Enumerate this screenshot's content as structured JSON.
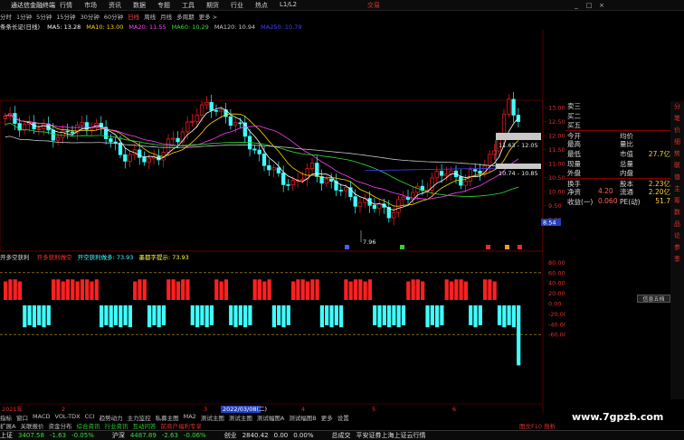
{
  "menubar": {
    "app_title": "通达信金融终端",
    "items": [
      "行情",
      "市场",
      "资讯",
      "数据",
      "专题",
      "工具",
      "期货",
      "行业",
      "热点",
      "L1/L2"
    ],
    "brand": "交易",
    "win_controls": [
      "_",
      "□",
      "×"
    ]
  },
  "timeframes": [
    "分时",
    "1分钟",
    "5分钟",
    "15分钟",
    "30分钟",
    "60分钟",
    "日线",
    "周线",
    "月线",
    "多周期",
    "更多 >"
  ],
  "active_timeframe": "日线",
  "ma_legend": {
    "stock": "条条长证(日线)",
    "items": [
      {
        "label": "MA5: 13.28",
        "color": "#ffffff"
      },
      {
        "label": "MA10: 13.00",
        "color": "#ffd700"
      },
      {
        "label": "MA20: 11.55",
        "color": "#ff40ff"
      },
      {
        "label": "MA60: 10.29",
        "color": "#30e030"
      },
      {
        "label": "MA120: 10.94",
        "color": "#c8c8c8"
      },
      {
        "label": "MA250: 10.79",
        "color": "#4040ff"
      }
    ]
  },
  "price_axis": [
    "13.00",
    "12.50",
    "12.00",
    "11.50",
    "11.00",
    "10.50",
    "10.00",
    "9.50",
    "9.00"
  ],
  "annotations": {
    "low_label": "7.96",
    "box1": "11.63 - 12.05",
    "box2": "10.74 - 10.85",
    "last_price": "8.54"
  },
  "quote": {
    "rows": [
      {
        "l": "卖三",
        "v": "",
        "l2": "",
        "v2": ""
      },
      {
        "l": "买二",
        "v": "",
        "l2": "",
        "v2": ""
      },
      {
        "l": "买五",
        "v": "",
        "l2": "",
        "v2": ""
      },
      {
        "l": "今开",
        "v": "",
        "l2": "均价",
        "v2": ""
      },
      {
        "l": "最高",
        "v": "",
        "l2": "量比",
        "v2": ""
      },
      {
        "l": "最低",
        "v": "",
        "l2": "市值",
        "v2": "27.7亿"
      },
      {
        "l": "现量",
        "v": "",
        "l2": "总量",
        "v2": ""
      },
      {
        "l": "外盘",
        "v": "",
        "l2": "内盘",
        "v2": ""
      },
      {
        "l": "换手",
        "v": "",
        "l2": "股本",
        "v2": "2.23亿"
      },
      {
        "l": "净资",
        "v": "4.20",
        "l2": "流通",
        "v2": "2.20亿"
      },
      {
        "l": "收益(一)",
        "v": "0.060",
        "l2": "PE(动)",
        "v2": "51.7"
      }
    ]
  },
  "indicator": {
    "title": "开多空获利",
    "items": [
      {
        "label": "开多获利做空",
        "color": "#ff3030"
      },
      {
        "label": "开空获利做多: 73.93",
        "color": "#40ffff"
      },
      {
        "label": "墨都字提示: 73.93",
        "color": "#ffff40"
      }
    ],
    "axis": [
      "80.00",
      "60.00",
      "40.00",
      "20.00",
      "0.00",
      "-20.00",
      "-40.00",
      "-60.00"
    ]
  },
  "date_axis": {
    "left": "2021年",
    "mid": "2022/03/08(二)",
    "ticks": [
      "2",
      "3",
      "4",
      "5",
      "6"
    ]
  },
  "tabs_row1": [
    "指标",
    "窗口",
    "MACD",
    "VOL-TDX",
    "CCI",
    "趋势动力",
    "主力监控",
    "私募主图",
    "MA2",
    "测试主图",
    "测试主图",
    "测试幅图A",
    "测试幅图B",
    "更多",
    "设置"
  ],
  "tabs_row2": [
    "扩展A",
    "关联报价",
    "资金分布",
    "综合资讯",
    "行业资讯",
    "互动问答",
    "前商户福利专享"
  ],
  "statusbar": [
    {
      "t": "上证",
      "c": "#e0e0e0"
    },
    {
      "t": "3407.58",
      "c": "#30e030"
    },
    {
      "t": "-1.63",
      "c": "#30e030"
    },
    {
      "t": "-0.05%",
      "c": "#30e030"
    },
    {
      "t": "沪深",
      "c": "#e0e0e0"
    },
    {
      "t": "4487.89",
      "c": "#30e030"
    },
    {
      "t": "-2.63",
      "c": "#30e030"
    },
    {
      "t": "-0.06%",
      "c": "#30e030"
    },
    {
      "t": "创业",
      "c": "#e0e0e0"
    },
    {
      "t": "2840.42",
      "c": "#e0e0e0"
    },
    {
      "t": "0.00",
      "c": "#e0e0e0"
    },
    {
      "t": "0.00%",
      "c": "#e0e0e0"
    },
    {
      "t": "总成交",
      "c": "#e0e0e0"
    },
    {
      "t": "平安证券上海上证云行情",
      "c": "#e0e0e0"
    }
  ],
  "sidebar_items": [
    "分",
    "笔",
    "价",
    "细",
    "势",
    "联",
    "值",
    "主",
    "筹",
    "数",
    "品",
    "论",
    "参",
    "季"
  ],
  "side_tab": "信息五档",
  "watermark": "www.7gpzb.com",
  "bottom_right": "图文F10 剖析",
  "colors": {
    "up": "#ff2020",
    "down": "#40ffff",
    "bg": "#000000",
    "grid": "#8a0000"
  }
}
